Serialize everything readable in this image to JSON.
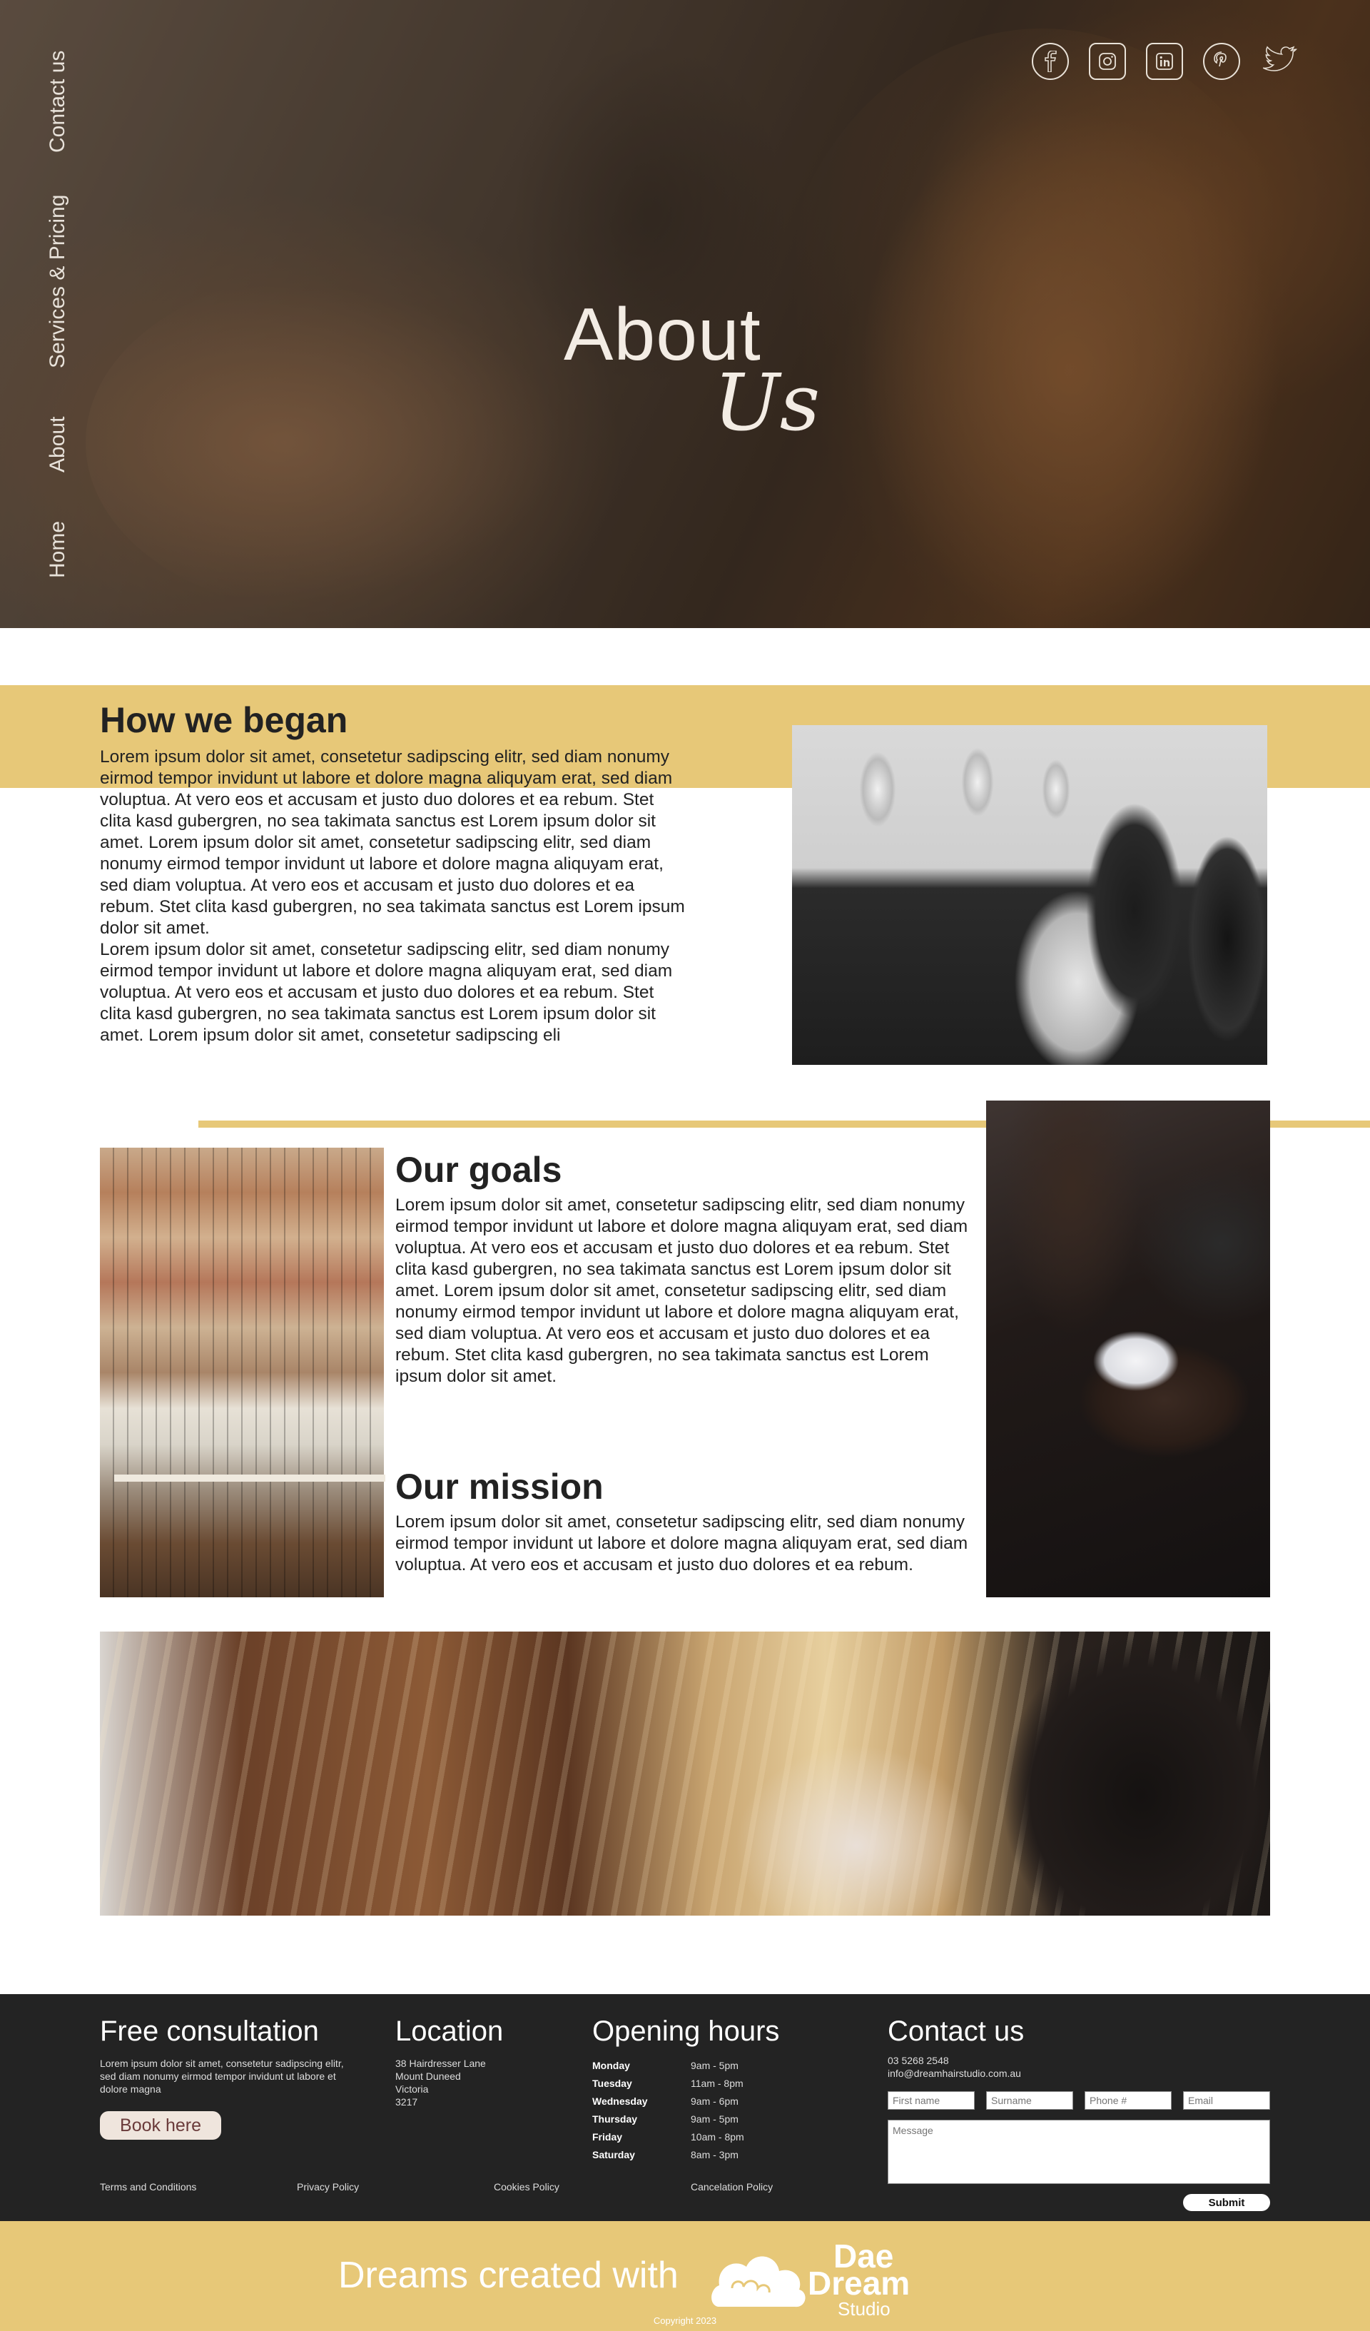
{
  "nav": {
    "items": [
      "Contact us",
      "Services & Pricing",
      "About",
      "Home"
    ]
  },
  "social": {
    "icons": [
      "facebook-icon",
      "instagram-icon",
      "linkedin-icon",
      "pinterest-icon",
      "twitter-icon"
    ]
  },
  "hero": {
    "title": "About",
    "script": "Us"
  },
  "began": {
    "title": "How we began",
    "paragraph1": "Lorem ipsum dolor sit amet, consetetur sadipscing elitr, sed diam nonumy eirmod tempor invidunt ut labore et dolore magna aliquyam erat, sed diam voluptua. At vero eos et accusam et justo duo dolores et ea rebum. Stet clita kasd gubergren, no sea takimata sanctus est Lorem ipsum dolor sit amet. Lorem ipsum dolor sit amet, consetetur sadipscing elitr, sed diam nonumy eirmod tempor invidunt ut labore et dolore magna aliquyam erat, sed diam voluptua. At vero eos et accusam et justo duo dolores et ea rebum. Stet clita kasd gubergren, no sea takimata sanctus est Lorem ipsum dolor sit amet.",
    "paragraph2": "Lorem ipsum dolor sit amet, consetetur sadipscing elitr, sed diam nonumy eirmod tempor invidunt ut labore et dolore magna aliquyam erat, sed diam voluptua. At vero eos et accusam et justo duo dolores et ea rebum. Stet clita kasd gubergren, no sea takimata sanctus est Lorem ipsum dolor sit amet. Lorem ipsum dolor sit amet, consetetur sadipscing eli"
  },
  "goals": {
    "title": "Our goals",
    "text": "Lorem ipsum dolor sit amet, consetetur sadipscing elitr, sed diam nonumy eirmod tempor invidunt ut labore et dolore magna aliquyam erat, sed diam voluptua. At vero eos et accusam et justo duo dolores et ea rebum. Stet clita kasd gubergren, no sea takimata sanctus est Lorem ipsum dolor sit amet. Lorem ipsum dolor sit amet, consetetur sadipscing elitr, sed diam nonumy eirmod tempor invidunt ut labore et dolore magna aliquyam erat, sed diam voluptua. At vero eos et accusam et justo duo dolores et ea rebum. Stet clita kasd gubergren, no sea takimata sanctus est Lorem ipsum dolor sit amet."
  },
  "mission": {
    "title": "Our mission",
    "text": "Lorem ipsum dolor sit amet, consetetur sadipscing elitr, sed diam nonumy eirmod tempor invidunt ut labore et dolore magna aliquyam erat, sed diam voluptua. At vero eos et accusam et justo duo dolores et ea rebum."
  },
  "footer": {
    "consultation": {
      "title": "Free consultation",
      "text": "Lorem ipsum dolor sit amet, consetetur sadipscing elitr, sed diam nonumy eirmod tempor invidunt ut labore et dolore magna",
      "button": "Book here"
    },
    "location": {
      "title": "Location",
      "lines": [
        "38 Hairdresser Lane",
        "Mount Duneed",
        "Victoria",
        "3217"
      ]
    },
    "hours": {
      "title": "Opening hours",
      "rows": [
        {
          "day": "Monday",
          "time": "9am - 5pm"
        },
        {
          "day": "Tuesday",
          "time": "11am - 8pm"
        },
        {
          "day": "Wednesday",
          "time": "9am - 6pm"
        },
        {
          "day": "Thursday",
          "time": "9am - 5pm"
        },
        {
          "day": "Friday",
          "time": "10am - 8pm"
        },
        {
          "day": "Saturday",
          "time": "8am - 3pm"
        }
      ]
    },
    "contact": {
      "title": "Contact us",
      "phone": "03 5268 2548",
      "email": "info@dreamhairstudio.com.au",
      "first_name_placeholder": "First name",
      "surname_placeholder": "Surname",
      "phone_placeholder": "Phone #",
      "email_placeholder": "Email",
      "message_placeholder": "Message",
      "submit": "Submit"
    },
    "links": [
      "Terms and Conditions",
      "Privacy Policy",
      "Cookies Policy",
      "Cancelation Policy"
    ]
  },
  "brand": {
    "tagline": "Dreams created with",
    "name_line1": "Dae",
    "name_line2": "Dream",
    "name_line3": "Studio",
    "copyright": "Copyright 2023"
  },
  "colors": {
    "gold": "#e7c878",
    "footer_bg": "#232323",
    "text_dark": "#222222"
  }
}
